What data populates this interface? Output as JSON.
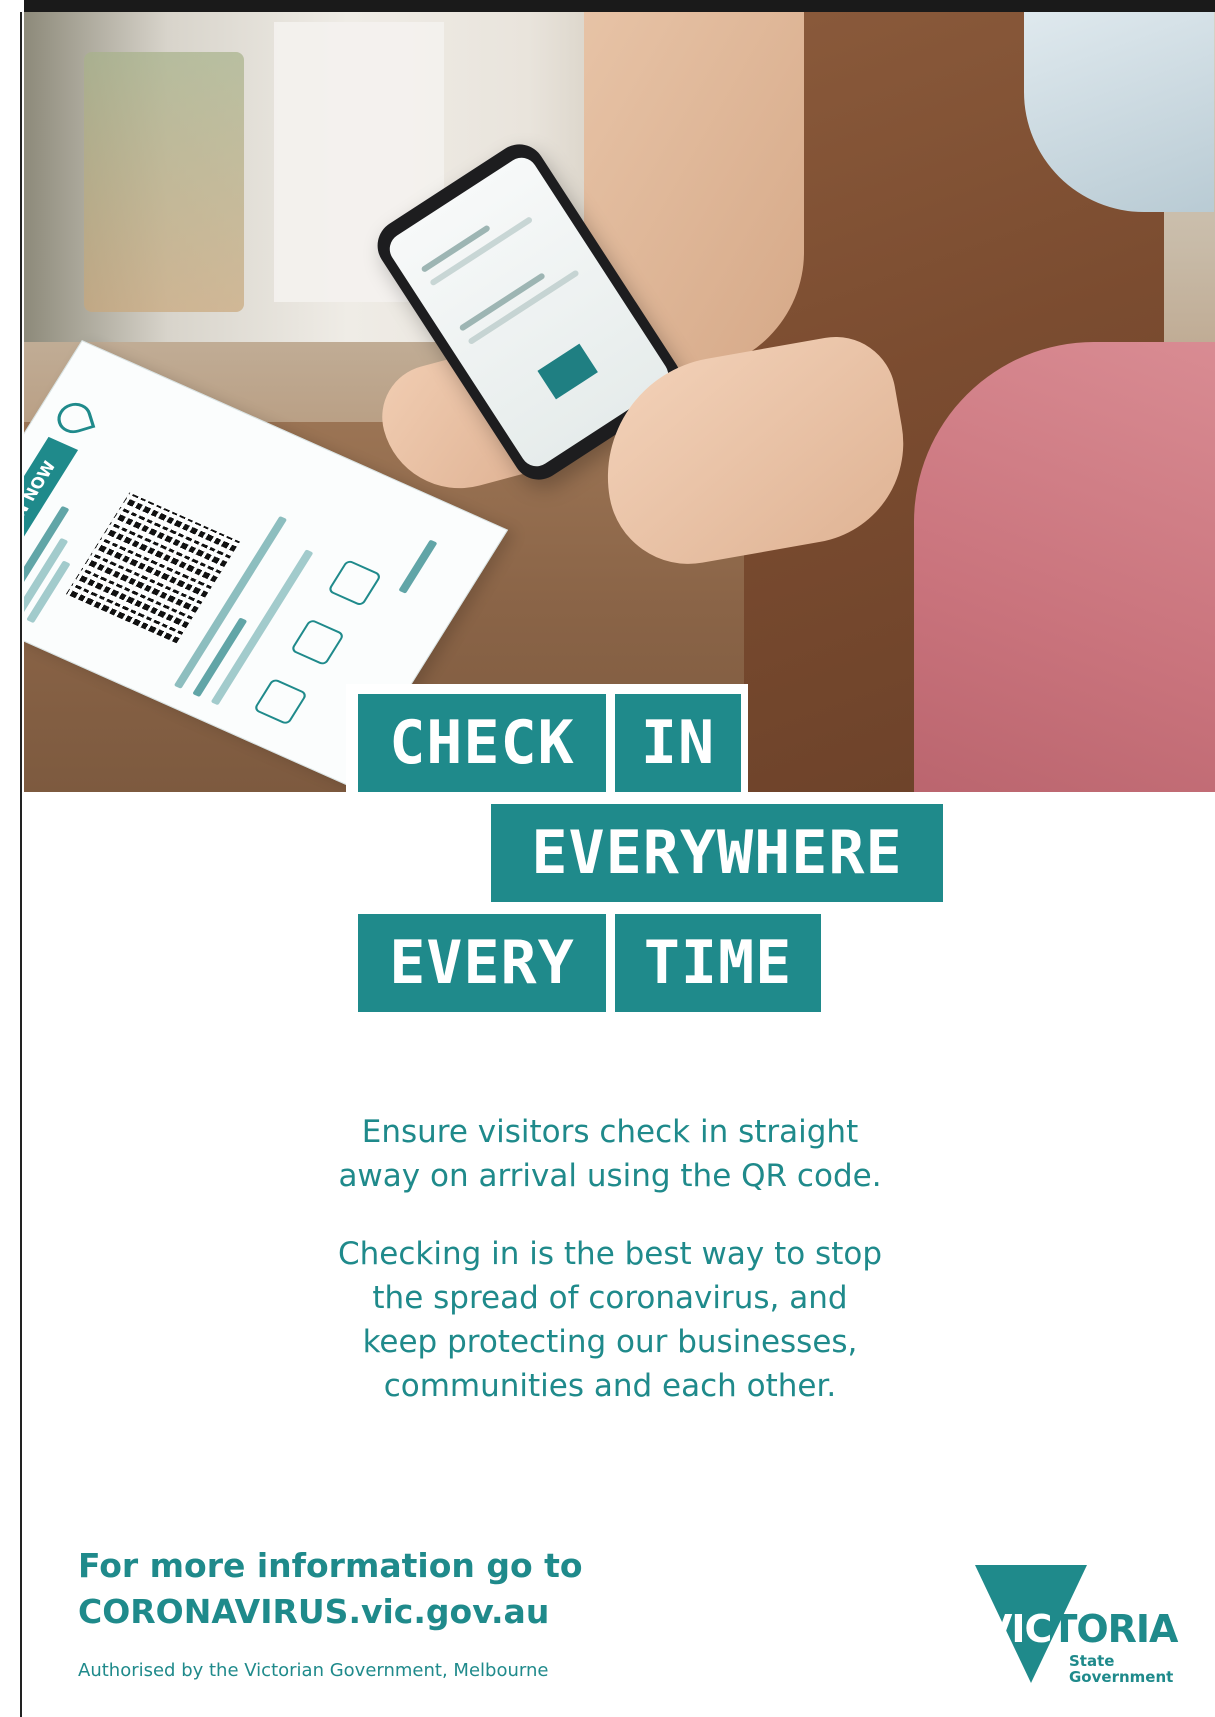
{
  "headline": {
    "word1": "CHECK",
    "word2": "IN",
    "word3": "EVERYWHERE",
    "word4": "EVERY",
    "word5": "TIME"
  },
  "body": {
    "paragraph1_line1": "Ensure visitors check in straight",
    "paragraph1_line2": "away on arrival using the QR code.",
    "paragraph2_line1": "Checking in is the best way to stop",
    "paragraph2_line2": "the spread of coronavirus, and",
    "paragraph2_line3": "keep protecting our businesses,",
    "paragraph2_line4": "communities and each other."
  },
  "footer": {
    "more_info_line1": "For more information go to",
    "more_info_line2": "CORONAVIRUS.vic.gov.au",
    "authorised": "Authorised by the Victorian Government, Melbourne"
  },
  "photo_card": {
    "badge": "CHECK IN NOW"
  },
  "logo": {
    "word_part1": "VIC",
    "word_part2": "TORIA",
    "line1": "State",
    "line2": "Government"
  },
  "colors": {
    "teal": "#1f8a8b",
    "white": "#ffffff"
  },
  "icons": [
    "qr-code-icon",
    "location-pin-icon",
    "phone-icon"
  ]
}
